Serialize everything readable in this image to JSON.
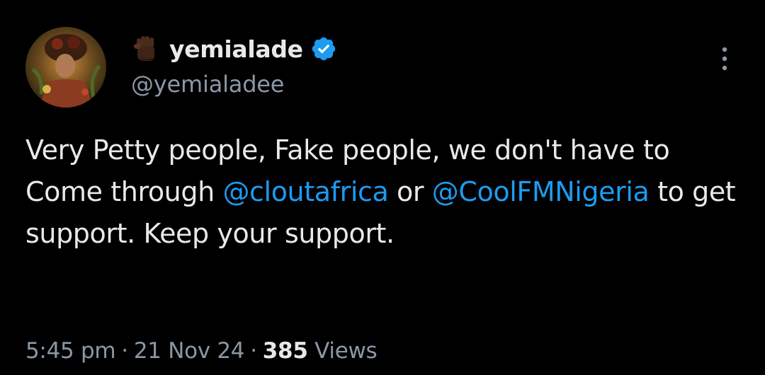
{
  "author": {
    "display_name": "yemialade",
    "handle": "@yemialadee",
    "emoji_icon": "raised-fist-icon",
    "verified_icon": "verified-badge-icon"
  },
  "tweet": {
    "text_part1": "Very Petty people, Fake people, we don't have to Come through ",
    "mention1": "@cloutafrica",
    "text_part2": " or ",
    "mention2": "@CoolFMNigeria",
    "text_part3": " to get support. Keep your support."
  },
  "meta": {
    "time": "5:45 pm",
    "separator": "·",
    "date": "21 Nov 24",
    "views_count": "385",
    "views_label": "Views"
  },
  "colors": {
    "background": "#000000",
    "text": "#e7e9ea",
    "secondary": "#8b98a5",
    "link": "#1d9bf0",
    "verified": "#1d9bf0"
  },
  "menu": {
    "icon": "more-vertical-icon"
  }
}
